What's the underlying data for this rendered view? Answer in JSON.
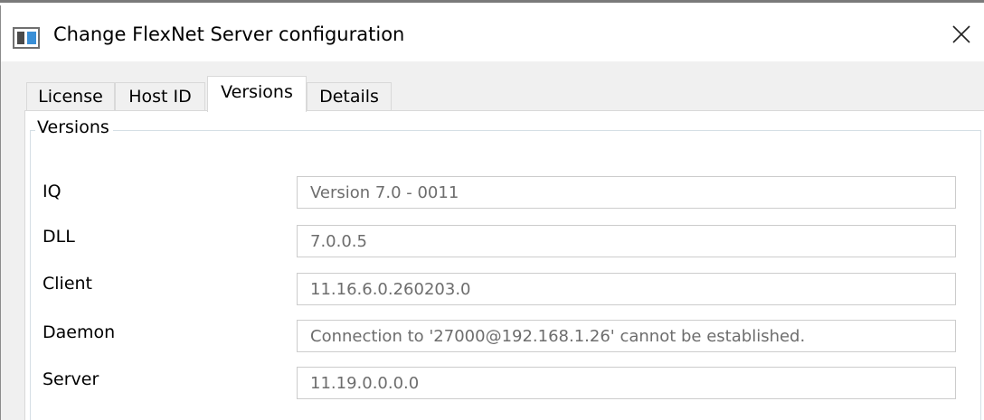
{
  "window": {
    "title": "Change FlexNet Server configuration",
    "icon": "application-window-icon",
    "close_glyph": "✕"
  },
  "tabs": [
    {
      "label": "License",
      "active": false
    },
    {
      "label": "Host ID",
      "active": false
    },
    {
      "label": "Versions",
      "active": true
    },
    {
      "label": "Details",
      "active": false
    }
  ],
  "versions_group": {
    "label": "Versions",
    "rows": [
      {
        "label": "IQ",
        "value": "Version 7.0 - 0011"
      },
      {
        "label": "DLL",
        "value": "7.0.0.5"
      },
      {
        "label": "Client",
        "value": "11.16.6.0.260203.0"
      },
      {
        "label": "Daemon",
        "value": "Connection to '27000@192.168.1.26' cannot be established."
      },
      {
        "label": "Server",
        "value": "11.19.0.0.0.0"
      }
    ]
  },
  "colors": {
    "dialog_bg": "#f0f0f0",
    "panel_bg": "#ffffff",
    "readonly_text": "#6d6d6d",
    "icon_accent": "#3a8fd6"
  }
}
